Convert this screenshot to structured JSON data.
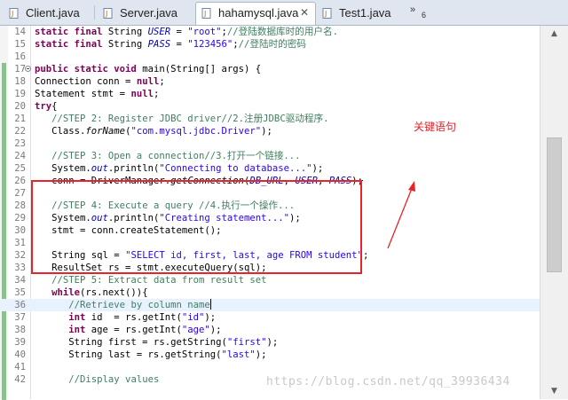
{
  "tabs": [
    {
      "label": "Client.java",
      "icon": "java-file-icon"
    },
    {
      "label": "Server.java",
      "icon": "java-file-icon"
    },
    {
      "label": "hahamysql.java",
      "icon": "java-file-icon",
      "active": true,
      "close": "✕"
    },
    {
      "label": "Test1.java",
      "icon": "java-file-icon"
    }
  ],
  "tab_overflow": {
    "symbol": "»",
    "count": "6"
  },
  "lines": [
    {
      "num": "14",
      "html": "<span class=\"k\">static final</span> String <span class=\"f\">USER</span> = <span class=\"s\">\"root\"</span>;<span class=\"c\">//登陆数据库时的用户名.</span>"
    },
    {
      "num": "15",
      "html": "<span class=\"k\">static final</span> String <span class=\"f\">PASS</span> = <span class=\"s\">\"123456\"</span>;<span class=\"c\">//登陆时的密码</span>"
    },
    {
      "num": "16",
      "html": ""
    },
    {
      "num": "17",
      "html": "<span class=\"k\">public static void</span> main(String[] args) {",
      "fold": true
    },
    {
      "num": "18",
      "html": "Connection conn = <span class=\"k\">null</span>;"
    },
    {
      "num": "19",
      "html": "Statement stmt = <span class=\"k\">null</span>;"
    },
    {
      "num": "20",
      "html": "<span class=\"k\">try</span>{"
    },
    {
      "num": "21",
      "html": "   <span class=\"c\">//STEP 2: Register JDBC driver//2.注册JDBC驱动程序.</span>"
    },
    {
      "num": "22",
      "html": "   Class.<span class=\"m\">forName</span>(<span class=\"s\">\"com.mysql.jdbc.Driver\"</span>);"
    },
    {
      "num": "23",
      "html": ""
    },
    {
      "num": "24",
      "html": "   <span class=\"c\">//STEP 3: Open a connection//3.打开一个链接...</span>"
    },
    {
      "num": "25",
      "html": "   System.<span class=\"f\">out</span>.println(<span class=\"s\">\"Connecting to database...\"</span>);"
    },
    {
      "num": "26",
      "html": "   <span class=\"strike\">conn = DriverManager.<span class=\"m\">getConnection</span>(<span class=\"f\">DB_URL</span>, <span class=\"f\">USER</span>, <span class=\"f\">PASS</span>);</span>"
    },
    {
      "num": "27",
      "html": ""
    },
    {
      "num": "28",
      "html": "   <span class=\"c\">//STEP 4: Execute a query //4.执行一个操作...</span>"
    },
    {
      "num": "29",
      "html": "   System.<span class=\"f\">out</span>.println(<span class=\"s\">\"Creating statement...\"</span>);"
    },
    {
      "num": "30",
      "html": "   stmt = conn.createStatement();"
    },
    {
      "num": "31",
      "html": ""
    },
    {
      "num": "32",
      "html": "   String sql = <span class=\"s\">\"SELECT id, first, last, age FROM student\"</span>;"
    },
    {
      "num": "33",
      "html": "   ResultSet rs = stmt.executeQuery(sql);"
    },
    {
      "num": "34",
      "html": "   <span class=\"c\">//STEP 5: Extract data from result set</span>"
    },
    {
      "num": "35",
      "html": "   <span class=\"k\">while</span>(rs.next()){"
    },
    {
      "num": "36",
      "html": "      <span class=\"c\">//Retrieve by column name</span><span class=\"caret\"></span>",
      "current": true
    },
    {
      "num": "37",
      "html": "      <span class=\"k\">int</span> id  = rs.getInt(<span class=\"s\">\"id\"</span>);"
    },
    {
      "num": "38",
      "html": "      <span class=\"k\">int</span> age = rs.getInt(<span class=\"s\">\"age\"</span>);"
    },
    {
      "num": "39",
      "html": "      String first = rs.getString(<span class=\"s\">\"first\"</span>);"
    },
    {
      "num": "40",
      "html": "      String last = rs.getString(<span class=\"s\">\"last\"</span>);"
    },
    {
      "num": "41",
      "html": ""
    },
    {
      "num": "42",
      "html": "      <span class=\"c\">//Display values</span>"
    }
  ],
  "annotation": {
    "label": "关键语句",
    "color": "#e8232a"
  },
  "watermark": "https://blog.csdn.net/qq_39936434",
  "scrollbar": {
    "up": "▲",
    "down": "▼"
  }
}
